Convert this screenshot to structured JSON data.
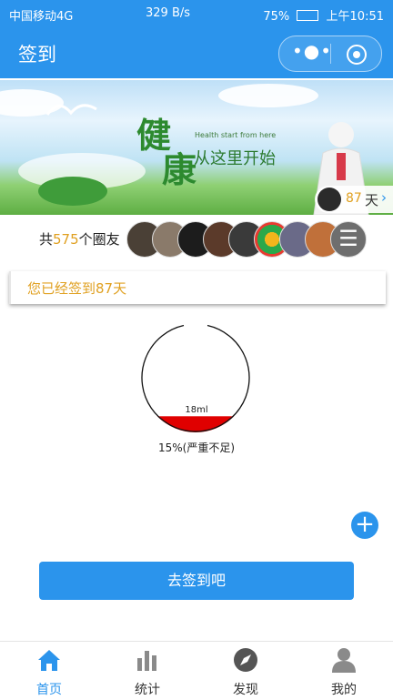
{
  "status_bar": {
    "carrier": "中国移动4G",
    "net_speed": "329 B/s",
    "battery": "75%",
    "time": "上午10:51"
  },
  "header": {
    "title": "签到",
    "menu_icon": "more-dots-icon",
    "close_icon": "target-circle-icon"
  },
  "banner": {
    "brand_char1": "健",
    "brand_char2": "康",
    "tagline_en": "Health start from here",
    "tagline_cn": "从这里开始",
    "days_value": "87",
    "days_unit": "天"
  },
  "members": {
    "prefix": "共",
    "count": "575",
    "suffix": "个圈友"
  },
  "checkin_status": "您已经签到87天",
  "gauge": {
    "volume_label": "18ml",
    "percent_text": "15%(严重不足)",
    "fill_fraction": 0.15,
    "fill_color": "#e00000"
  },
  "sign_button": "去签到吧",
  "tabs": [
    {
      "label": "首页",
      "icon": "home-icon",
      "active": true
    },
    {
      "label": "统计",
      "icon": "bar-chart-icon",
      "active": false
    },
    {
      "label": "发现",
      "icon": "compass-icon",
      "active": false
    },
    {
      "label": "我的",
      "icon": "user-icon",
      "active": false
    }
  ],
  "colors": {
    "primary": "#2b94ec",
    "accent": "#e0a020"
  }
}
